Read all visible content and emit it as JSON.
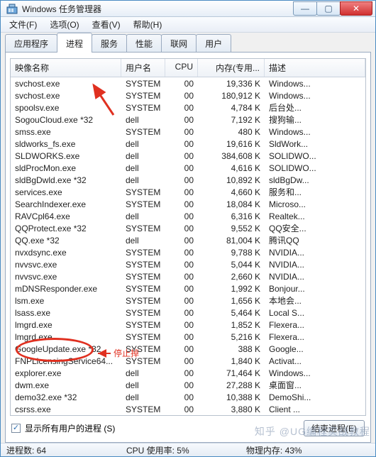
{
  "window": {
    "title": "Windows 任务管理器"
  },
  "menu": {
    "file": "文件(F)",
    "options": "选项(O)",
    "view": "查看(V)",
    "help": "帮助(H)"
  },
  "tabs": {
    "apps": "应用程序",
    "processes": "进程",
    "services": "服务",
    "performance": "性能",
    "networking": "联网",
    "users": "用户"
  },
  "columns": {
    "name": "映像名称",
    "user": "用户名",
    "cpu": "CPU",
    "mem": "内存(专用...",
    "desc": "描述"
  },
  "rows": [
    {
      "n": "svchost.exe",
      "u": "SYSTEM",
      "c": "00",
      "m": "19,336 K",
      "d": "Windows..."
    },
    {
      "n": "svchost.exe",
      "u": "SYSTEM",
      "c": "00",
      "m": "180,912 K",
      "d": "Windows..."
    },
    {
      "n": "spoolsv.exe",
      "u": "SYSTEM",
      "c": "00",
      "m": "4,784 K",
      "d": "后台处..."
    },
    {
      "n": "SogouCloud.exe *32",
      "u": "dell",
      "c": "00",
      "m": "7,192 K",
      "d": "搜狗输..."
    },
    {
      "n": "smss.exe",
      "u": "SYSTEM",
      "c": "00",
      "m": "480 K",
      "d": "Windows..."
    },
    {
      "n": "sldworks_fs.exe",
      "u": "dell",
      "c": "00",
      "m": "19,616 K",
      "d": "SldWork..."
    },
    {
      "n": "SLDWORKS.exe",
      "u": "dell",
      "c": "00",
      "m": "384,608 K",
      "d": "SOLIDWO..."
    },
    {
      "n": "sldProcMon.exe",
      "u": "dell",
      "c": "00",
      "m": "4,616 K",
      "d": "SOLIDWO..."
    },
    {
      "n": "sldBgDwld.exe *32",
      "u": "dell",
      "c": "00",
      "m": "10,892 K",
      "d": "sldBgDw..."
    },
    {
      "n": "services.exe",
      "u": "SYSTEM",
      "c": "00",
      "m": "4,660 K",
      "d": "服务和..."
    },
    {
      "n": "SearchIndexer.exe",
      "u": "SYSTEM",
      "c": "00",
      "m": "18,084 K",
      "d": "Microso..."
    },
    {
      "n": "RAVCpl64.exe",
      "u": "dell",
      "c": "00",
      "m": "6,316 K",
      "d": "Realtek..."
    },
    {
      "n": "QQProtect.exe *32",
      "u": "SYSTEM",
      "c": "00",
      "m": "9,552 K",
      "d": "QQ安全..."
    },
    {
      "n": "QQ.exe *32",
      "u": "dell",
      "c": "00",
      "m": "81,004 K",
      "d": "腾讯QQ"
    },
    {
      "n": "nvxdsync.exe",
      "u": "SYSTEM",
      "c": "00",
      "m": "9,788 K",
      "d": "NVIDIA..."
    },
    {
      "n": "nvvsvc.exe",
      "u": "SYSTEM",
      "c": "00",
      "m": "5,044 K",
      "d": "NVIDIA..."
    },
    {
      "n": "nvvsvc.exe",
      "u": "SYSTEM",
      "c": "00",
      "m": "2,660 K",
      "d": "NVIDIA..."
    },
    {
      "n": "mDNSResponder.exe",
      "u": "SYSTEM",
      "c": "00",
      "m": "1,992 K",
      "d": "Bonjour..."
    },
    {
      "n": "lsm.exe",
      "u": "SYSTEM",
      "c": "00",
      "m": "1,656 K",
      "d": "本地会..."
    },
    {
      "n": "lsass.exe",
      "u": "SYSTEM",
      "c": "00",
      "m": "5,464 K",
      "d": "Local S..."
    },
    {
      "n": "lmgrd.exe",
      "u": "SYSTEM",
      "c": "00",
      "m": "1,852 K",
      "d": "Flexera..."
    },
    {
      "n": "lmgrd.exe",
      "u": "SYSTEM",
      "c": "00",
      "m": "5,216 K",
      "d": "Flexera..."
    },
    {
      "n": "GoogleUpdate.exe *32",
      "u": "SYSTEM",
      "c": "00",
      "m": "388 K",
      "d": "Google..."
    },
    {
      "n": "FNPLicensingService64...",
      "u": "SYSTEM",
      "c": "00",
      "m": "1,840 K",
      "d": "Activat..."
    },
    {
      "n": "explorer.exe",
      "u": "dell",
      "c": "00",
      "m": "71,464 K",
      "d": "Windows..."
    },
    {
      "n": "dwm.exe",
      "u": "dell",
      "c": "00",
      "m": "27,288 K",
      "d": "桌面窗..."
    },
    {
      "n": "demo32.exe *32",
      "u": "dell",
      "c": "00",
      "m": "10,388 K",
      "d": "DemoShi..."
    },
    {
      "n": "csrss.exe",
      "u": "SYSTEM",
      "c": "00",
      "m": "3,880 K",
      "d": "Client ..."
    }
  ],
  "checkbox": {
    "label": "显示所有用户的进程 (S)"
  },
  "buttons": {
    "end": "结束进程(E)"
  },
  "status": {
    "procs": "进程数: 64",
    "cpu": "CPU 使用率: 5%",
    "mem": "物理内存: 43%"
  },
  "annotation": {
    "stop": "停止掉"
  },
  "watermark": "知乎 @UG编程实战教程"
}
